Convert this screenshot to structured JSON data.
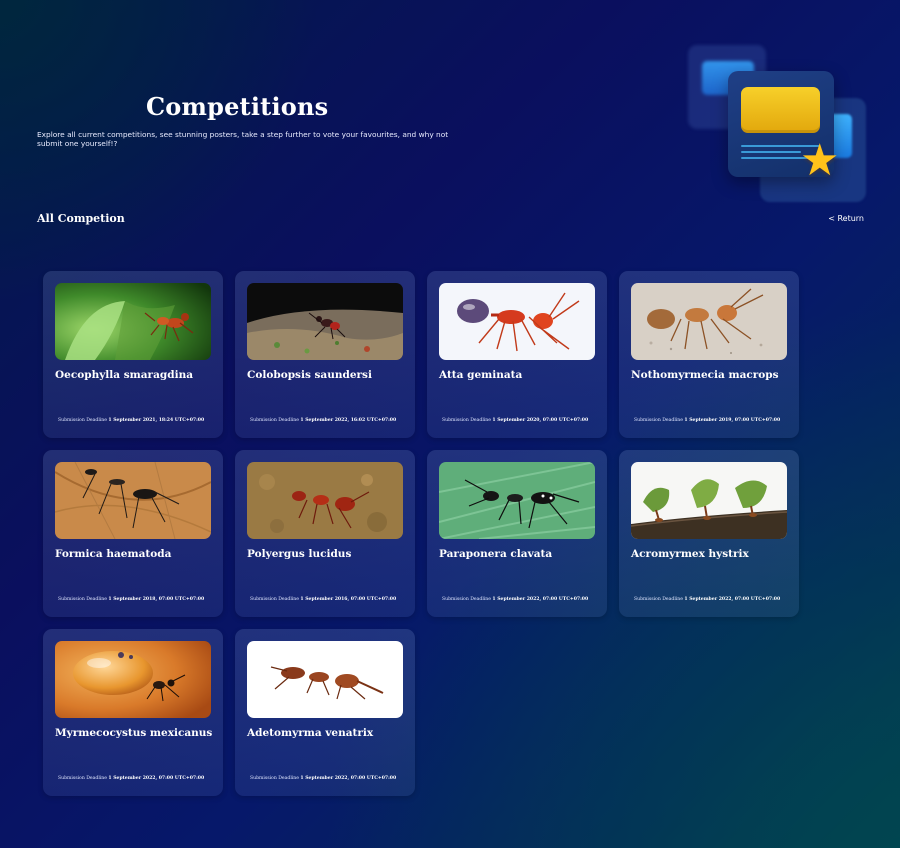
{
  "header": {
    "title": "Competitions",
    "subtitle": "Explore all current competitions, see stunning posters, take a step further to vote your favourites, and why not submit one yourself!?"
  },
  "section": {
    "title": "All Competion",
    "return_label": "< Return"
  },
  "deadline_label": "Submission Deadline",
  "competitions": [
    {
      "name": "Oecophylla smaragdina",
      "deadline": "1 September 2021, 18:24 UTC+07:00",
      "image": "green-weaver-ant-on-leaf"
    },
    {
      "name": "Colobopsis saundersi",
      "deadline": "1 September 2022, 16:02 UTC+07:00",
      "image": "ant-on-mossy-branch"
    },
    {
      "name": "Atta geminata",
      "deadline": "1 September 2020, 07:00 UTC+07:00",
      "image": "red-ant-white-background"
    },
    {
      "name": "Nothomyrmecia macrops",
      "deadline": "1 September 2019, 07:00 UTC+07:00",
      "image": "orange-ant-on-sand"
    },
    {
      "name": "Formica haematoda",
      "deadline": "1 September 2018, 07:00 UTC+07:00",
      "image": "ant-on-dry-leaf"
    },
    {
      "name": "Polyergus lucidus",
      "deadline": "1 September 2016, 07:00 UTC+07:00",
      "image": "red-ant-on-ground"
    },
    {
      "name": "Paraponera clavata",
      "deadline": "1 September 2022, 07:00 UTC+07:00",
      "image": "black-ant-on-green-leaf"
    },
    {
      "name": "Acromyrmex hystrix",
      "deadline": "1 September 2022, 07:00 UTC+07:00",
      "image": "leafcutter-ants-carrying-leaves"
    },
    {
      "name": "Myrmecocystus mexicanus",
      "deadline": "1 September 2022, 07:00 UTC+07:00",
      "image": "honeypot-ant-amber"
    },
    {
      "name": "Adetomyrma venatrix",
      "deadline": "1 September 2022, 07:00 UTC+07:00",
      "image": "dracula-ant-white-background"
    }
  ],
  "hero": {
    "illustration": "competition-cards-star-icon"
  },
  "colors": {
    "star": "#ffc21a",
    "card_yellow": "#f7d02a",
    "accent_blue": "#37a8ff"
  }
}
